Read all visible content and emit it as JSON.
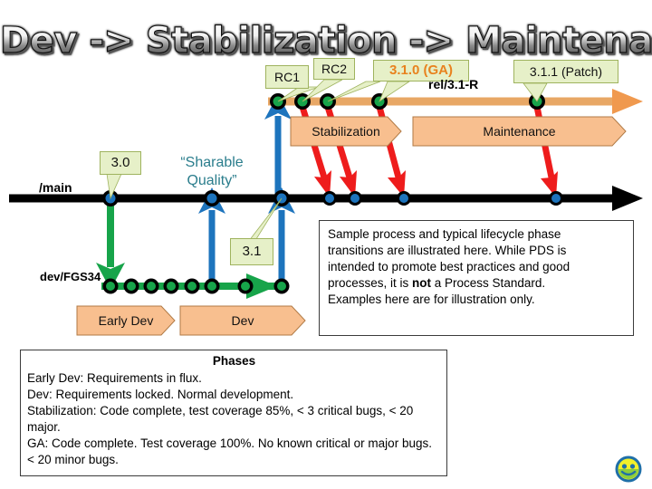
{
  "title": "Dev -> Stabilization -> Maintenance",
  "branches": {
    "main_label": "/main",
    "dev_label": "dev/FGS34",
    "release_label": "rel/3.1-R"
  },
  "callouts": [
    {
      "id": "rc1",
      "label": "RC1"
    },
    {
      "id": "rc2",
      "label": "RC2"
    },
    {
      "id": "ga",
      "label": "3.1.0 (GA)"
    },
    {
      "id": "patch",
      "label": "3.1.1 (Patch)"
    },
    {
      "id": "v30",
      "label": "3.0"
    },
    {
      "id": "v31",
      "label": "3.1"
    }
  ],
  "phase_arrows": [
    {
      "id": "stabilization",
      "label": "Stabilization"
    },
    {
      "id": "maintenance",
      "label": "Maintenance"
    },
    {
      "id": "early-dev",
      "label": "Early Dev"
    },
    {
      "id": "dev",
      "label": "Dev"
    }
  ],
  "annotation": {
    "sharable_quality_line1": "“Sharable",
    "sharable_quality_line2": "Quality”"
  },
  "note_sample": {
    "line1": "Sample process and typical lifecycle phase",
    "line2": "transitions are illustrated here.  While PDS is",
    "line3": "intended to promote best practices and good",
    "line4_a": "processes, it is ",
    "line4_b": "not",
    "line4_c": " a Process Standard.",
    "line5": "Examples here are for illustration only."
  },
  "note_phases": {
    "title": "Phases",
    "line1": "Early Dev:  Requirements in flux.",
    "line2": "Dev: Requirements locked.  Normal development.",
    "line3": "Stabilization:  Code complete, test coverage 85%, < 3 critical bugs, < 20 major.",
    "line4": "GA:  Code complete.  Test coverage 100%. No known critical or major bugs.  < 20 minor bugs."
  },
  "icons": {
    "smiley": "smiley-face-icon"
  },
  "colors": {
    "release_line": "#e8a765",
    "release_arrow": "#f0994e",
    "main_line": "#000000",
    "dev_line": "#17a44a",
    "merge_up": "#1d74bd",
    "merge_down": "#ee1c1c",
    "branch_down": "#17a44a",
    "callout_fill": "#e6f0c8",
    "callout_border": "#9fb35e",
    "chevron_fill": "#f8bf8f",
    "chevron_border": "#b07a45",
    "ga_text": "#e8821e",
    "sharable_text": "#2a7d8c",
    "node_green": "#17a44a",
    "node_blue": "#1d74bd"
  }
}
